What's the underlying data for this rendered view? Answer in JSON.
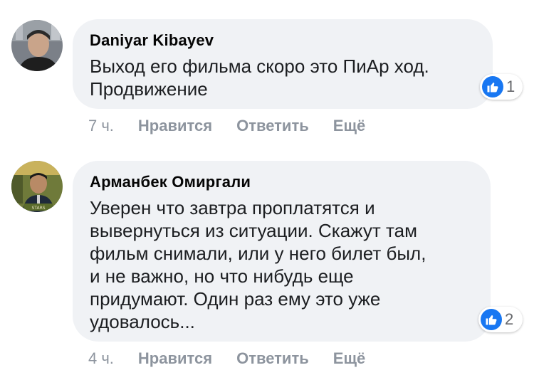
{
  "comments": [
    {
      "author": "Daniyar Kibayev",
      "text_lines": [
        "Выход его фильма скоро это ПиАр ход.",
        "Продвижение"
      ],
      "reaction_count": "1",
      "time": "7 ч.",
      "like_label": "Нравится",
      "reply_label": "Ответить",
      "more_label": "Ещё"
    },
    {
      "author": "Арманбек Омиргали",
      "text_lines": [
        "Уверен что завтра проплатятся и",
        "вывернуться из ситуации. Скажут там",
        "фильм снимали, или у него билет был,",
        "и не важно, но что нибудь еще",
        "придумают. Один раз ему это уже",
        "удовалось..."
      ],
      "reaction_count": "2",
      "time": "4 ч.",
      "like_label": "Нравится",
      "reply_label": "Ответить",
      "more_label": "Ещё"
    }
  ],
  "colors": {
    "bubble": "#f0f2f5",
    "like_blue": "#1877f2",
    "meta_gray": "#8d949e"
  },
  "icons": {
    "reaction": "thumbs-up-icon"
  }
}
